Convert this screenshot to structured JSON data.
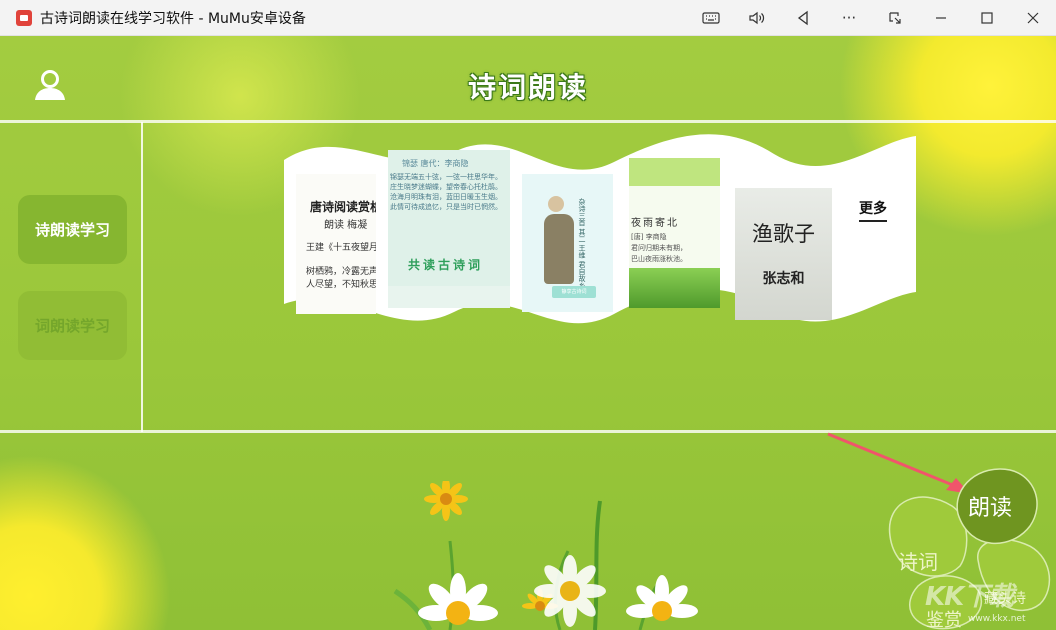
{
  "window": {
    "title": "古诗词朗读在线学习软件 - MuMu安卓设备",
    "tools": [
      "keyboard-icon",
      "volume-icon",
      "back-icon",
      "more-icon",
      "restore-window-icon",
      "minimize-icon",
      "maximize-icon",
      "close-icon"
    ],
    "more_glyph": "···"
  },
  "header": {
    "title": "诗词朗读"
  },
  "sidebar": {
    "items": [
      {
        "label": "诗朗读学习",
        "active": true
      },
      {
        "label": "词朗读学习",
        "active": false
      }
    ]
  },
  "carousel": {
    "cards": [
      {
        "title": "唐诗阅读赏析",
        "subtitle": "朗读  梅凝",
        "line1": "王建《十五夜望月》",
        "line2": "树栖鸦，冷露无声",
        "line3": "人尽望，不知秋思"
      },
      {
        "header": "锦瑟    唐代：李商隐",
        "text": [
          "锦瑟无端五十弦，一弦一柱思华年。",
          "庄生晓梦迷蝴蝶，望帝春心托杜鹃。",
          "沧海月明珠有泪，蓝田日暖玉生烟。",
          "此情可待成追忆，只是当时已惘然。"
        ],
        "label": "共读古诗词"
      },
      {
        "vertical_text": "杂诗三首 其二  王维  君自故乡来",
        "book": "静享古诗词"
      },
      {
        "title": "夜雨寄北",
        "author": "[唐] 李商隐",
        "lines": [
          "君问归期未有期，",
          "巴山夜雨涨秋池。"
        ]
      },
      {
        "title": "渔歌子",
        "author": "张志和"
      }
    ],
    "more_label": "更多"
  },
  "menu": {
    "items": [
      "朗读",
      "诗词",
      "藏头诗",
      "鉴赏"
    ],
    "active": "朗读"
  },
  "watermark": {
    "text": "KK下载",
    "url": "www.kkx.net"
  },
  "colors": {
    "background": "#9fca3b",
    "sidebar_active": "#86b630",
    "sidebar_inactive": "#91bd35",
    "menu_active": "#6f9520",
    "arrow": "#f0556b"
  }
}
